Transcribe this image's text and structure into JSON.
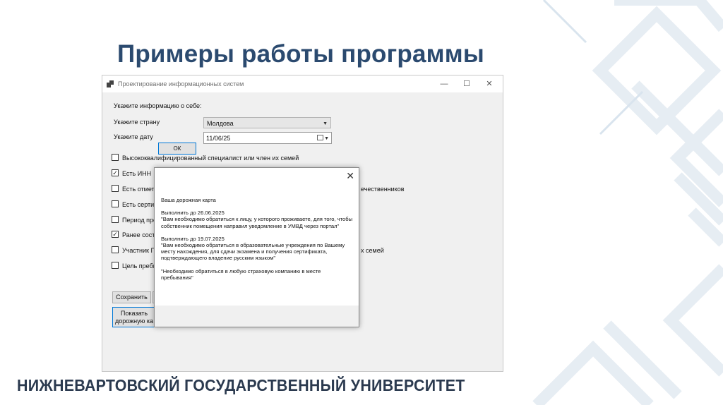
{
  "slide": {
    "title": "Примеры работы программы",
    "footer": "НИЖНЕВАРТОВСКИЙ ГОСУДАРСТВЕННЫЙ УНИВЕРСИТЕТ"
  },
  "window": {
    "title": "Проектирование информационных систем",
    "minimize": "—",
    "maximize": "☐",
    "close": "✕"
  },
  "form": {
    "about_label": "Укажите информацию о себе:",
    "country_label": "Укажите страну",
    "country_value": "Молдова",
    "date_label": "Укажите дату",
    "date_value": "11/06/25",
    "checkboxes": [
      {
        "label": "Высококвалифицированный специалист или член их семей",
        "checked": false
      },
      {
        "label": "Есть ИНН",
        "checked": true
      },
      {
        "label": "Есть отмет",
        "checked": false,
        "suffix": "ечественников"
      },
      {
        "label": "Есть сертиф",
        "checked": false
      },
      {
        "label": "Период пре",
        "checked": false
      },
      {
        "label": "Ранее состо",
        "checked": true
      },
      {
        "label": "Участник Го",
        "checked": false,
        "suffix": "х семей"
      },
      {
        "label": "Цель пребы",
        "checked": false
      }
    ],
    "save_button": "Сохранить",
    "show_button_line1": "Показать",
    "show_button_line2": "дорожную ка"
  },
  "dialog": {
    "close": "✕",
    "heading": "Ваша дорожная карта",
    "item1_date": "Выполнить до 26.06.2025",
    "item1_text": "\"Вам необходимо обратиться к лицу, у которого проживаете, для того, чтобы собственник помещения направил уведомление в УМВД через портал\"",
    "item2_date": "Выполнить до 19.07.2025",
    "item2_text": "\"Вам необходимо обратиться в образовательные учреждения по Вашему месту нахождения, для сдачи экзамена и получения сертификата, подтверждающего владение русским языком\"",
    "item3_text": "\"Необходимо обратиться в любую страховую компанию в месте пребывания\"",
    "ok_button": "ОК"
  }
}
